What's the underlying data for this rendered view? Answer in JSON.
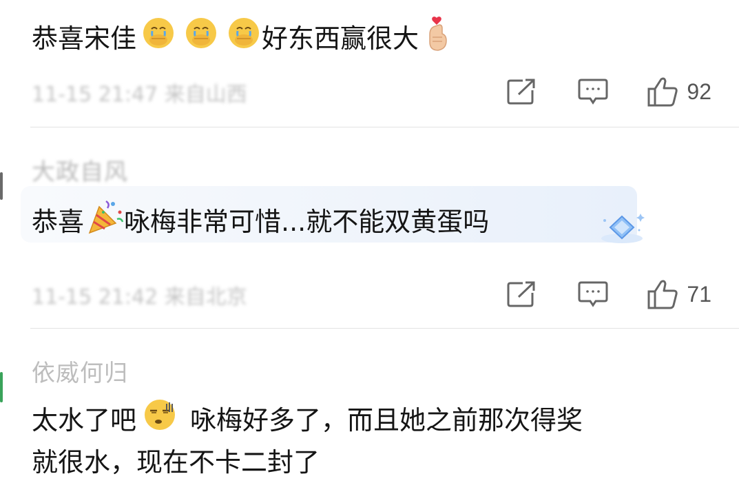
{
  "comments": [
    {
      "text_a": "恭喜宋佳",
      "text_b": "好东西赢很大",
      "meta": "11-15 21:47 来自山西",
      "likes": "92"
    },
    {
      "username": "大政自风",
      "text_a": "恭喜",
      "text_b": "咏梅非常可惜...就不能双黄蛋吗",
      "meta": "11-15 21:42 来自北京",
      "likes": "71"
    },
    {
      "username": "依威何归",
      "text_line1_a": "太水了吧",
      "text_line1_b": "咏梅好多了，而且她之前那次得奖",
      "text_line2": "就很水，现在不卡二封了"
    }
  ],
  "icons": {
    "share": "share-icon",
    "comment": "comment-icon",
    "like": "thumbs-up-icon",
    "emoji_cover_face": "cover-face-emoji",
    "emoji_finger_heart": "finger-heart-emoji",
    "emoji_party": "party-popper-emoji",
    "emoji_sweat": "sweat-emoji",
    "fan_badge": "diamond-fan-badge-icon"
  },
  "colors": {
    "text": "#151515",
    "icon": "#666666",
    "muted": "#c3c3c3",
    "divider": "#e3e3e3",
    "emoji_yellow": "#f7c948",
    "badge_blue": "#6ea8f5"
  }
}
